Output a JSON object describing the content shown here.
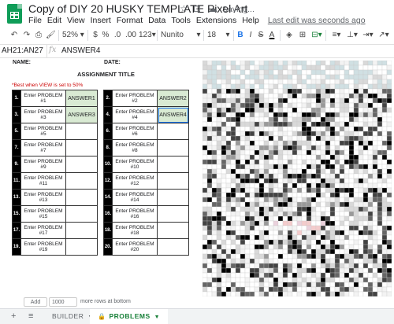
{
  "app": {
    "doc_title": "Copy of DIY 20 HUSKY TEMPLATE Pixel Art",
    "saving_status": "Saving...",
    "menus": [
      "File",
      "Edit",
      "View",
      "Insert",
      "Format",
      "Data",
      "Tools",
      "Extensions",
      "Help"
    ],
    "last_edit": "Last edit was seconds ago"
  },
  "toolbar": {
    "zoom": "52%",
    "currency": "$",
    "percent": "%",
    "dec_less": ".0",
    "dec_more": ".00",
    "more_formats": "123",
    "font": "Nunito",
    "font_size": "18",
    "bold": "B",
    "italic": "I",
    "strike": "S",
    "text_color": "A"
  },
  "formula_bar": {
    "name_box": "AH21:AN27",
    "fx": "fx",
    "value": "ANSWER4"
  },
  "sheet": {
    "name_label": "NAME:",
    "date_label": "DATE:",
    "title": "ASSIGNMENT TITLE",
    "note": "*Best when VIEW is set to 50%",
    "left_rows": [
      {
        "num": "1.",
        "problem": "Enter PROBLEM #1",
        "answer": "ANSWER1"
      },
      {
        "num": "3.",
        "problem": "Enter PROBLEM #3",
        "answer": "ANSWER3"
      },
      {
        "num": "5.",
        "problem": "Enter PROBLEM #5",
        "answer": ""
      },
      {
        "num": "7.",
        "problem": "Enter PROBLEM #7",
        "answer": ""
      },
      {
        "num": "9.",
        "problem": "Enter PROBLEM #9",
        "answer": ""
      },
      {
        "num": "11.",
        "problem": "Enter PROBLEM #11",
        "answer": ""
      },
      {
        "num": "13.",
        "problem": "Enter PROBLEM #13",
        "answer": ""
      },
      {
        "num": "15.",
        "problem": "Enter PROBLEM #15",
        "answer": ""
      },
      {
        "num": "17.",
        "problem": "Enter PROBLEM #17",
        "answer": ""
      },
      {
        "num": "19.",
        "problem": "Enter PROBLEM #19",
        "answer": ""
      }
    ],
    "right_rows": [
      {
        "num": "2.",
        "problem": "Enter PROBLEM #2",
        "answer": "ANSWER2"
      },
      {
        "num": "4.",
        "problem": "Enter PROBLEM #4",
        "answer": "ANSWER4"
      },
      {
        "num": "6.",
        "problem": "Enter PROBLEM #6",
        "answer": ""
      },
      {
        "num": "8.",
        "problem": "Enter PROBLEM #8",
        "answer": ""
      },
      {
        "num": "10.",
        "problem": "Enter PROBLEM #10",
        "answer": ""
      },
      {
        "num": "12.",
        "problem": "Enter PROBLEM #12",
        "answer": ""
      },
      {
        "num": "14.",
        "problem": "Enter PROBLEM #14",
        "answer": ""
      },
      {
        "num": "16.",
        "problem": "Enter PROBLEM #16",
        "answer": ""
      },
      {
        "num": "18.",
        "problem": "Enter PROBLEM #18",
        "answer": ""
      },
      {
        "num": "20.",
        "problem": "Enter PROBLEM #20",
        "answer": ""
      }
    ],
    "answer_fill_color": "#d9ead3",
    "pixel_palette": [
      "#ffffff",
      "#f3f3f3",
      "#d9d9d9",
      "#b7b7b7",
      "#999999",
      "#666666",
      "#434343",
      "#000000",
      "#d0e0e3",
      "#f4cccc",
      "#ead1dc"
    ]
  },
  "add_rows": {
    "button": "Add",
    "count": "1000",
    "hint": "more rows at bottom"
  },
  "tabs": {
    "sheets": [
      {
        "label": "BUILDER",
        "active": false
      },
      {
        "label": "PROBLEMS",
        "active": true
      }
    ]
  }
}
